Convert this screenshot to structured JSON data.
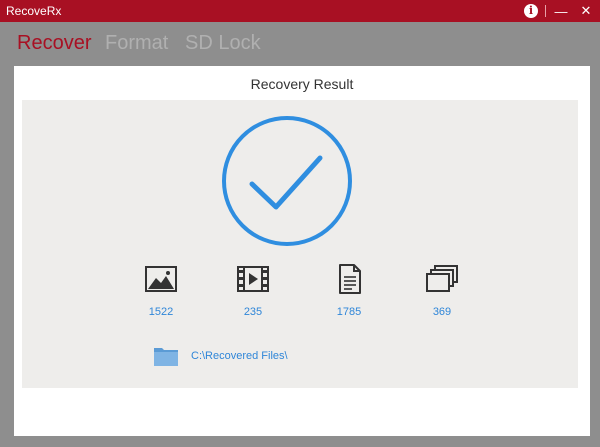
{
  "window": {
    "title": "RecoveRx",
    "minimize_glyph": "—",
    "close_glyph": "✕",
    "info_glyph": "i"
  },
  "tabs": [
    {
      "label": "Recover",
      "active": true
    },
    {
      "label": "Format",
      "active": false
    },
    {
      "label": "SD Lock",
      "active": false
    }
  ],
  "result": {
    "title": "Recovery Result",
    "status_icon": "checkmark-circle-icon",
    "categories": [
      {
        "icon": "photo-icon",
        "count": "1522"
      },
      {
        "icon": "video-icon",
        "count": "235"
      },
      {
        "icon": "document-icon",
        "count": "1785"
      },
      {
        "icon": "other-files-icon",
        "count": "369"
      }
    ],
    "folder": {
      "icon": "folder-icon",
      "path": "C:\\Recovered Files\\"
    }
  },
  "colors": {
    "brand": "#a81023",
    "accent_blue": "#2f86d8",
    "panel_bg": "#eeedeb"
  }
}
